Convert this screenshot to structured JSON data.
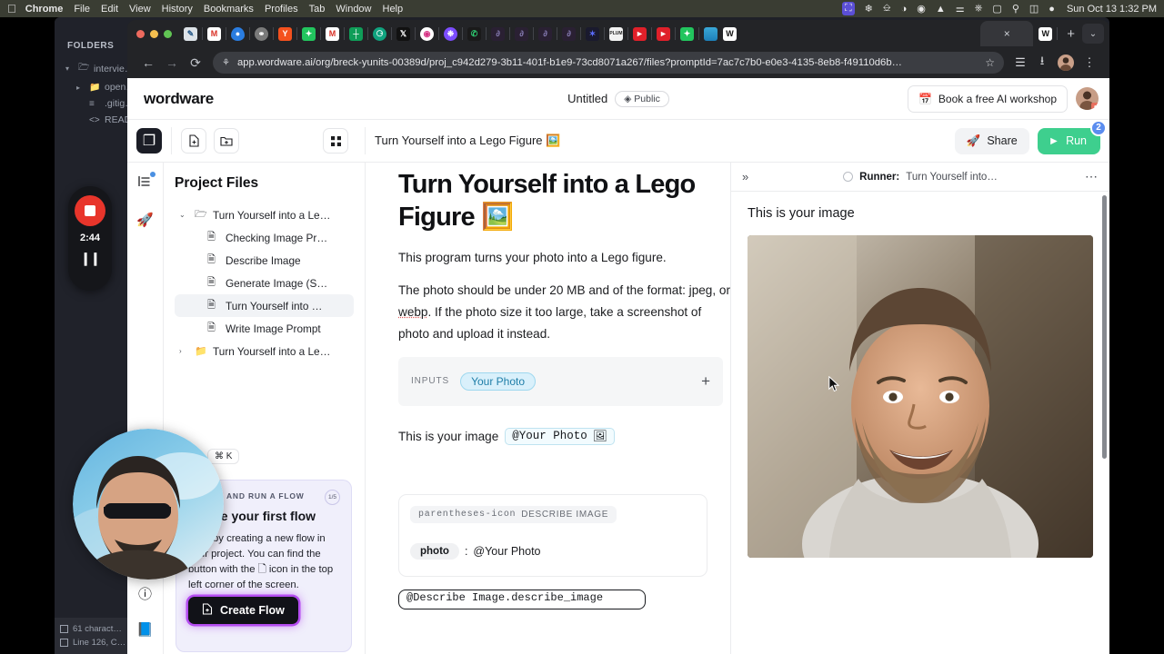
{
  "macos": {
    "apple_icon": "apple-logo",
    "menus": [
      "Chrome",
      "File",
      "Edit",
      "View",
      "History",
      "Bookmarks",
      "Profiles",
      "Tab",
      "Window",
      "Help"
    ],
    "status_icons": [
      "screen-share-icon",
      "snowflake-icon",
      "shield-icon",
      "wifi-icon",
      "control-center-icon",
      "notification-bell-icon",
      "apple-tv-icon",
      "bluetooth-icon",
      "battery-icon",
      "search-icon",
      "stack-icon",
      "siri-icon"
    ],
    "clock": "Sun Oct 13  1:32 PM"
  },
  "browser": {
    "tab_active_label": "×",
    "new_tab_label": "+",
    "tab_list_chevron": "⌄",
    "nav": {
      "back": "←",
      "forward": "→",
      "reload": "⟳"
    },
    "url": "app.wordware.ai/org/breck-yunits-00389d/proj_c942d279-3b11-401f-b1e9-73cd8071a267/files?promptId=7ac7c7b0-e0e3-4135-8eb8-f49110d6b…",
    "site_icon": "permissions-icon",
    "bookmark_icon": "star-icon",
    "toolbar_icons": [
      "reading-list-icon",
      "download-icon",
      "profile-avatar-icon",
      "chrome-menu-icon"
    ]
  },
  "vscode": {
    "folders_label": "FOLDERS",
    "tree": [
      {
        "label": "intervie…",
        "icon": "folder-open-icon",
        "twisty": "▾"
      },
      {
        "label": "open…",
        "icon": "folder-icon",
        "twisty": "▸"
      },
      {
        "label": ".gitig…",
        "icon": "settings-file-icon",
        "twisty": ""
      },
      {
        "label": "READ…",
        "icon": "code-file-icon",
        "twisty": ""
      }
    ],
    "status": {
      "characters": "61 charact…",
      "line": "Line 126, C…"
    }
  },
  "recorder": {
    "time": "2:44",
    "stop_icon": "stop-record-icon",
    "pause_icon": "pause-icon"
  },
  "app": {
    "brand": "wordware",
    "doc_title": "Untitled",
    "visibility": "Public",
    "visibility_icon": "globe-icon",
    "workshop_button": "Book a free AI workshop",
    "workshop_icon": "calendar-icon",
    "avatar_name": "user-avatar"
  },
  "toolbar": {
    "documents_icon": "documents-icon",
    "new_file_icon": "new-file-icon",
    "new_folder_icon": "new-folder-icon",
    "grid_icon": "grid-view-icon",
    "flow_title": "Turn Yourself into a Lego Figure 🖼️",
    "share_label": "Share",
    "share_icon": "rocket-icon",
    "run_label": "Run",
    "run_icon": "play-icon",
    "run_badge": "2"
  },
  "rail": {
    "items": [
      "structure-icon",
      "rocket-icon"
    ],
    "bottom": [
      "help-icon",
      "docs-icon"
    ]
  },
  "files": {
    "heading": "Project Files",
    "items": [
      {
        "label": "Turn Yourself into a Le…",
        "type": "folder",
        "twisty": "⌄",
        "selected": false,
        "child": false
      },
      {
        "label": "Checking Image Pr…",
        "type": "file",
        "twisty": "",
        "selected": false,
        "child": true
      },
      {
        "label": "Describe Image",
        "type": "file",
        "twisty": "",
        "selected": false,
        "child": true
      },
      {
        "label": "Generate Image (S…",
        "type": "file",
        "twisty": "",
        "selected": false,
        "child": true
      },
      {
        "label": "Turn Yourself into …",
        "type": "file",
        "twisty": "",
        "selected": true,
        "child": true
      },
      {
        "label": "Write Image Prompt",
        "type": "file",
        "twisty": "",
        "selected": false,
        "child": true
      },
      {
        "label": "Turn Yourself into a Le…",
        "type": "folder",
        "twisty": "›",
        "selected": false,
        "child": false
      }
    ]
  },
  "doc": {
    "title": "Turn Yourself into a Lego Figure",
    "title_emoji": "🖼️",
    "para1": "This program turns your photo into a Lego figure.",
    "para2_a": "The photo should be under 20 MB and of the format:",
    "para2_b": "jpeg, or ",
    "para2_webp": "webp",
    "para2_c": ". If the photo size it too large, take a",
    "para2_d": "screenshot of photo and upload it instead.",
    "inputs_label": "INPUTS",
    "input_chip": "Your Photo",
    "add_input": "+",
    "image_line_text": "This is your image",
    "image_mention": "@Your Photo",
    "image_mention_icon": "image-icon",
    "describe_card": {
      "tag": "DESCRIBE IMAGE",
      "tag_icon": "parentheses-icon",
      "key": "photo",
      "separator": ":",
      "value": "@Your Photo"
    },
    "bottom_pill": "@Describe Image.describe_image"
  },
  "runner": {
    "expand_icon": "expand-right-icon",
    "label_prefix": "Runner:",
    "label_value": "Turn Yourself into…",
    "status_icon": "loading-spinner-icon",
    "menu_icon": "more-options-icon",
    "output_text": "This is your image",
    "image_alt": "generated-portrait"
  },
  "popup": {
    "shortcut": "⌘ K",
    "eyebrow": "CREATE AND RUN A FLOW",
    "heading": "Create your first flow",
    "body": "Start by creating a new flow in your project. You can find the button with the 🗋 icon in the top left corner of the screen.",
    "progress": "1/5",
    "button_label": "Create Flow",
    "button_icon": "new-file-icon"
  },
  "colors": {
    "run_green": "#3ecf8e",
    "badge_blue": "#5b8def",
    "chip_blue": "#d9f0fb",
    "popup_bg": "#f0effb",
    "purple_glow": "#b44cf0",
    "record_red": "#e8352b"
  }
}
